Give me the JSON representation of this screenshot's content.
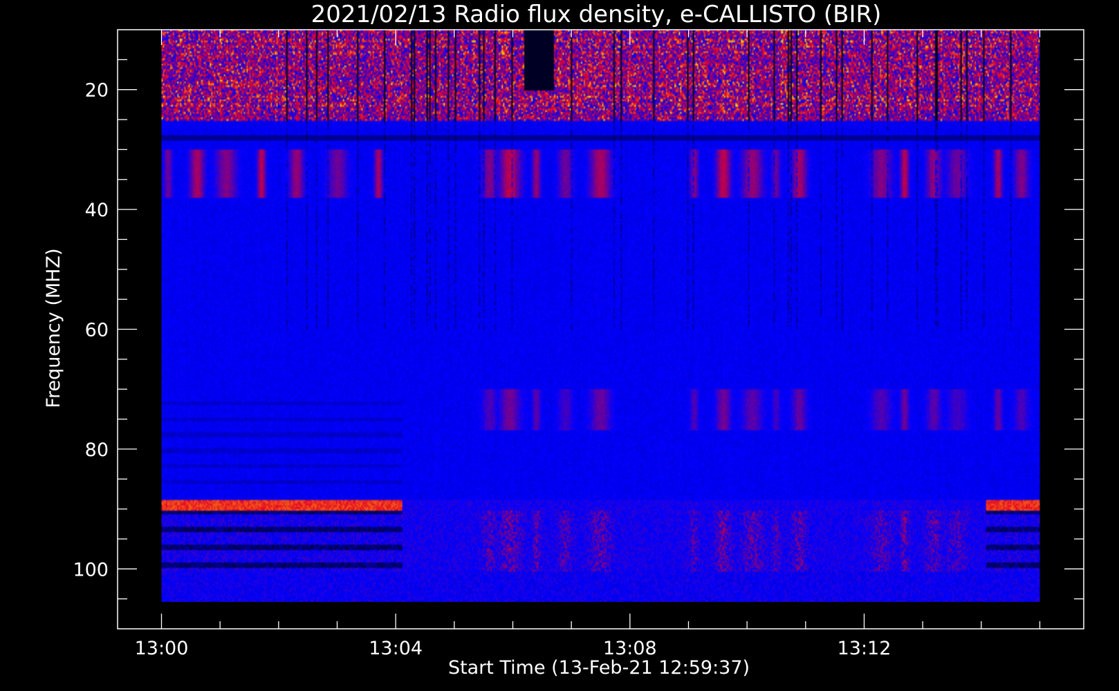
{
  "chart_data": {
    "type": "heatmap",
    "title": "2021/02/13  Radio flux density, e-CALLISTO (BIR)",
    "xlabel": "Start Time (13-Feb-21 12:59:37)",
    "ylabel": "Frequency (MHZ)",
    "x_ticks": [
      "13:00",
      "13:04",
      "13:08",
      "13:12"
    ],
    "y_ticks": [
      20,
      40,
      60,
      80,
      100
    ],
    "x_range_minutes": [
      -0.75,
      15.75
    ],
    "data_x_range_minutes": [
      0,
      15
    ],
    "y_range_mhz": [
      10,
      110
    ],
    "data_y_range_mhz": [
      10,
      105.5
    ],
    "y_inverted": true,
    "colormap": [
      "#000000",
      "#0000ff",
      "#ff0000",
      "#ffff00"
    ],
    "background": "#000000",
    "axis_color": "#ffffff"
  }
}
